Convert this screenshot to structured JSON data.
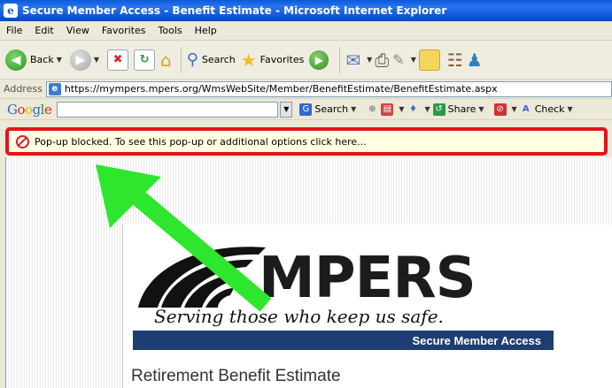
{
  "window": {
    "title": "Secure Member Access - Benefit Estimate - Microsoft Internet Explorer"
  },
  "menu": [
    "File",
    "Edit",
    "View",
    "Favorites",
    "Tools",
    "Help"
  ],
  "toolbar": {
    "back_label": "Back",
    "search_label": "Search",
    "favorites_label": "Favorites"
  },
  "address": {
    "label": "Address",
    "url": "https://mympers.mpers.org/WmsWebSite/Member/BenefitEstimate/BenefitEstimate.aspx"
  },
  "google_toolbar": {
    "logo": "Google",
    "search_label": "Search",
    "share_label": "Share",
    "check_label": "Check"
  },
  "infobar": {
    "message": "Pop-up blocked. To see this pop-up or additional options click here..."
  },
  "page": {
    "logo_text": "MPERS",
    "tagline": "Serving those who keep us safe.",
    "banner": "Secure Member Access",
    "heading": "Retirement Benefit Estimate"
  },
  "colors": {
    "infobar_border": "#e2141b",
    "arrow": "#2ee62e",
    "banner": "#1e3d72",
    "titlebar": "#0b56d4"
  }
}
